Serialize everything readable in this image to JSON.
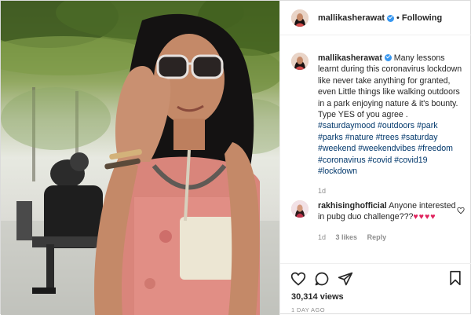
{
  "post": {
    "author": "mallikasherawat",
    "follow_state": "Following",
    "separator": "•"
  },
  "caption": {
    "username": "mallikasherawat",
    "text": " Many lessons learnt during this coronavirus lockdown like never take anything for granted, even Little things like walking outdoors in a park enjoying nature & it's bounty. Type YES of you agree . ",
    "hashtags": "#saturdaymood #outdoors #park #parks #nature #trees #saturday #weekend #weekendvibes #freedom #coronavirus #covid #covid19 #lockdown",
    "time": "1d"
  },
  "comment": {
    "username": "rakhisinghofficial",
    "text": " Anyone interested in pubg duo challenge???",
    "emoji": "♥♥♥♥",
    "time": "1d",
    "likes": "3 likes",
    "reply_label": "Reply"
  },
  "stats": {
    "views": "30,314 views",
    "posted": "1 DAY AGO"
  },
  "icons": {
    "like": "heart-icon",
    "comment": "comment-icon",
    "share": "share-icon",
    "save": "bookmark-icon",
    "comment_like": "heart-icon"
  },
  "colors": {
    "hashtag": "#00376b",
    "verified": "#3897f0",
    "secondary_text": "#8e8e8e",
    "heart_emoji": "#e0245e"
  }
}
